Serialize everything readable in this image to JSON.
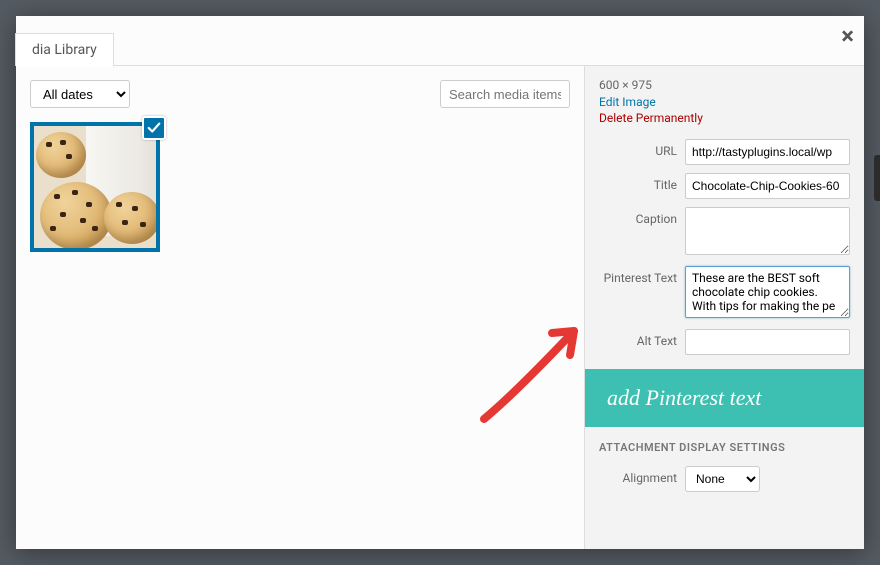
{
  "modal": {
    "close_glyph": "×"
  },
  "tabs": {
    "library": "dia Library"
  },
  "toolbar": {
    "dates_selected": "All dates",
    "search_placeholder": "Search media items."
  },
  "thumbnail": {
    "selected": true
  },
  "details": {
    "dimensions": "600 × 975",
    "edit_image_label": "Edit Image",
    "delete_label": "Delete Permanently",
    "url_label": "URL",
    "url_value": "http://tastyplugins.local/wp",
    "title_label": "Title",
    "title_value": "Chocolate-Chip-Cookies-60",
    "caption_label": "Caption",
    "caption_value": "",
    "pinterest_text_label": "Pinterest Text",
    "pinterest_text_value": "These are the BEST soft chocolate chip cookies. With tips for making the pe",
    "alt_text_label": "Alt Text",
    "alt_text_value": ""
  },
  "callout": {
    "text": "add Pinterest text"
  },
  "display_settings": {
    "heading": "ATTACHMENT DISPLAY SETTINGS",
    "alignment_label": "Alignment",
    "alignment_value": "None"
  }
}
